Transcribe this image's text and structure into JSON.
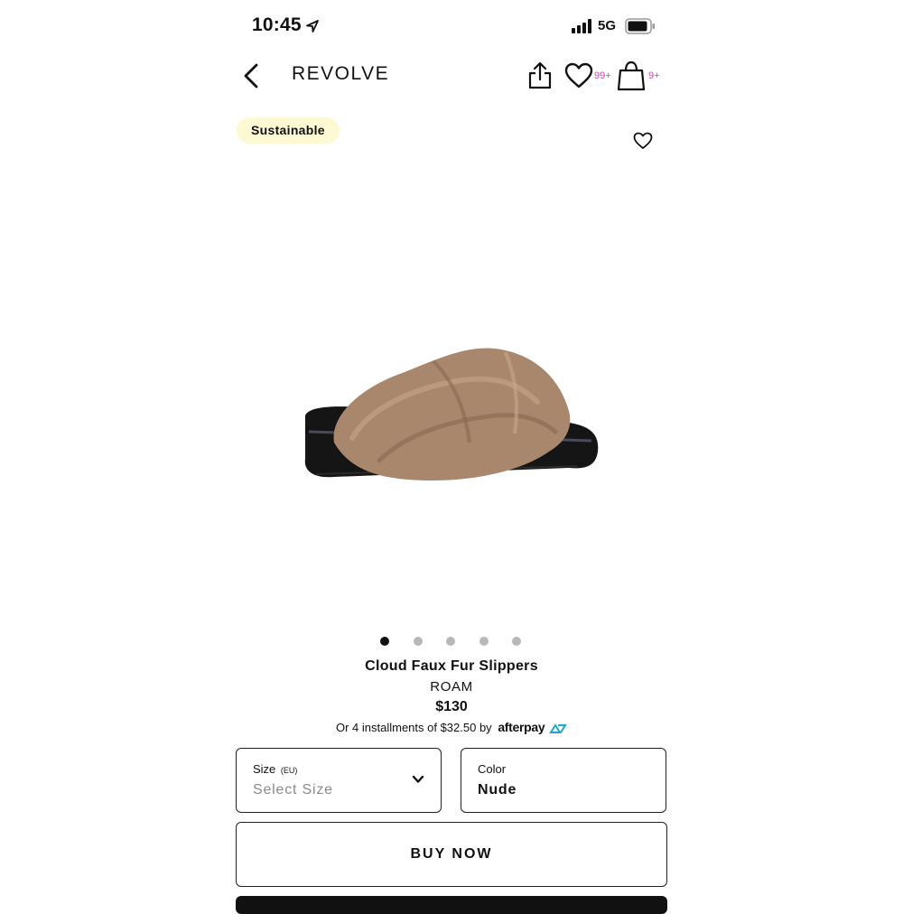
{
  "status_bar": {
    "time": "10:45",
    "network": "5G"
  },
  "nav": {
    "brand": "REVOLVE",
    "wishlist_count": "99+",
    "bag_count": "9+"
  },
  "product": {
    "badge": "Sustainable",
    "name": "Cloud Faux Fur Slippers",
    "brand": "ROAM",
    "price": "$130",
    "installments": "Or 4 installments of $32.50 by",
    "afterpay_label": "afterpay",
    "image_pages": 5,
    "current_page": 1
  },
  "size_selector": {
    "label": "Size",
    "unit": "(EU)",
    "placeholder": "Select Size"
  },
  "color_selector": {
    "label": "Color",
    "value": "Nude"
  },
  "actions": {
    "buy_now": "BUY NOW"
  },
  "colors": {
    "accent_count": "#e039c8",
    "badge_bg": "#fdf9d2",
    "fur": "#a9876d"
  }
}
